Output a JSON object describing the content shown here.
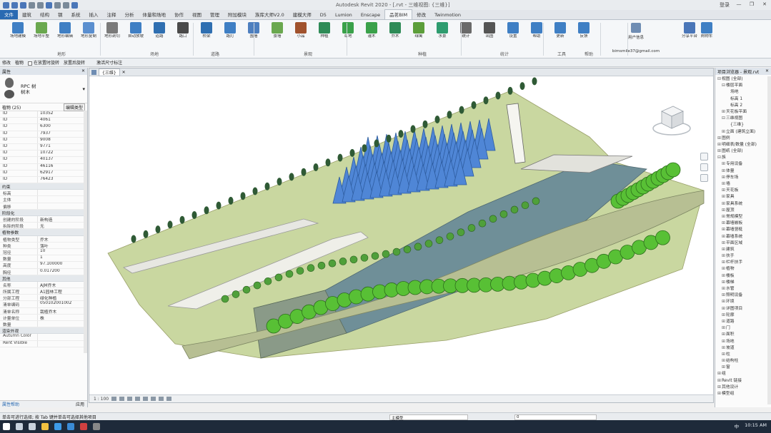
{
  "window": {
    "title": "Autodesk Revit 2020 - [.rvt - 三维视图: {三维}]",
    "user": "登录",
    "controls": [
      "—",
      "❐",
      "✕"
    ]
  },
  "ribbon_tabs": [
    "文件",
    "建筑",
    "结构",
    "钢",
    "系统",
    "插入",
    "注释",
    "分析",
    "体量和场地",
    "协作",
    "视图",
    "管理",
    "附加模块",
    "族库大师V2.0",
    "建模大师",
    "D5",
    "Lumion",
    "Enscape",
    "品茗BIM",
    "修改",
    "Twinmotion"
  ],
  "active_tab": "品茗BIM",
  "ribbon": {
    "buttons": [
      {
        "label": "场地建模",
        "color": "#3f7fc4"
      },
      {
        "label": "场地平整",
        "color": "#6aa84f"
      },
      {
        "label": "地形编辑",
        "color": "#3f7fc4"
      },
      {
        "label": "地形复制",
        "color": "#5b8fcf"
      },
      {
        "label": "地形剖切",
        "color": "#7a7a7a"
      },
      {
        "label": "自动放坡",
        "color": "#3f7fc4"
      },
      {
        "label": "道路",
        "color": "#2f6fb1"
      },
      {
        "label": "路口",
        "color": "#4a4a4a"
      },
      {
        "label": "桥梁",
        "color": "#2f6fb1"
      },
      {
        "label": "路灯",
        "color": "#3f7fc4"
      },
      {
        "label": "围墙",
        "color": "#4d7fbf"
      },
      {
        "label": "景墙",
        "color": "#6aa84f"
      },
      {
        "label": "小品",
        "color": "#a0522d"
      },
      {
        "label": "种植",
        "color": "#2e8b57"
      },
      {
        "label": "草地",
        "color": "#3aa14a"
      },
      {
        "label": "灌木",
        "color": "#3aa14a"
      },
      {
        "label": "乔木",
        "color": "#2e8b57"
      },
      {
        "label": "绿篱",
        "color": "#5c9e3a"
      },
      {
        "label": "水景",
        "color": "#2e9c6f"
      },
      {
        "label": "统计",
        "color": "#6a6a6a"
      },
      {
        "label": "出图",
        "color": "#555555"
      },
      {
        "label": "设置",
        "color": "#3f7fc4"
      },
      {
        "label": "帮助",
        "color": "#3f7fc4"
      },
      {
        "label": "更新",
        "color": "#3f7fc4"
      },
      {
        "label": "反馈",
        "color": "#3f7fc4"
      }
    ],
    "groups": [
      "地形",
      "场地",
      "道路",
      "景观",
      "种植",
      "统计",
      "工具",
      "帮助"
    ],
    "user_label": "用户信息",
    "user_email": "bimsmile37@gmail.com",
    "right_buttons": [
      {
        "label": "分享平台"
      },
      {
        "label": "购物车"
      }
    ]
  },
  "options_bar": {
    "items": [
      "修改",
      "植物"
    ],
    "check1": "在放置时旋转",
    "check2": "放置后旋转",
    "extra": "激活尺寸标注"
  },
  "properties": {
    "title": "属性",
    "type_name_1": "RPC 树",
    "type_name_2": "树木",
    "selector": "植物 (25)",
    "edit_type": "编辑类型",
    "list_rows": [
      {
        "k": "ID",
        "v": "10352"
      },
      {
        "k": "ID",
        "v": "4061"
      },
      {
        "k": "ID",
        "v": "6300"
      },
      {
        "k": "ID",
        "v": "7937"
      },
      {
        "k": "ID",
        "v": "9008"
      },
      {
        "k": "ID",
        "v": "9771"
      },
      {
        "k": "ID",
        "v": "10722"
      },
      {
        "k": "ID",
        "v": "40137"
      },
      {
        "k": "ID",
        "v": "46116"
      },
      {
        "k": "ID",
        "v": "62917"
      },
      {
        "k": "ID",
        "v": "76423"
      }
    ],
    "sections": [
      {
        "title": "约束",
        "rows": [
          {
            "k": "标高",
            "v": ""
          },
          {
            "k": "主体",
            "v": ""
          },
          {
            "k": "偏移",
            "v": ""
          }
        ]
      },
      {
        "title": "阶段化",
        "rows": [
          {
            "k": "创建的阶段",
            "v": "新构造"
          },
          {
            "k": "拆除的阶段",
            "v": "无"
          }
        ]
      },
      {
        "title": "植物参数",
        "rows": [
          {
            "k": "植物类型",
            "v": "乔木"
          },
          {
            "k": "种类",
            "v": "落叶"
          },
          {
            "k": "冠径",
            "v": "10"
          },
          {
            "k": "数量",
            "v": "1"
          },
          {
            "k": "高度",
            "v": "97.100000"
          },
          {
            "k": "胸径",
            "v": "0.017200"
          }
        ]
      },
      {
        "title": "其他",
        "rows": [
          {
            "k": "名称",
            "v": "AJM乔木"
          },
          {
            "k": "所属工程",
            "v": "A1园林工程"
          },
          {
            "k": "分部工程",
            "v": "绿化种植"
          },
          {
            "k": "清单编码",
            "v": "050102001002"
          },
          {
            "k": "清单名称",
            "v": "栽植乔木"
          },
          {
            "k": "计量单位",
            "v": "株"
          },
          {
            "k": "数量",
            "v": ""
          }
        ]
      },
      {
        "title": "渲染外观",
        "rows": [
          {
            "k": "Autumn Color",
            "v": ""
          },
          {
            "k": "Rent Visible",
            "v": ""
          }
        ]
      }
    ],
    "help_link": "属性帮助",
    "apply": "应用"
  },
  "viewport": {
    "tab": "{三维}",
    "viewbar_scale": "1 : 100"
  },
  "browser": {
    "title": "项目浏览器 - 景观.rvt",
    "items": [
      {
        "t": "视图 (全部)",
        "lvl": 0,
        "exp": "⊟"
      },
      {
        "t": "楼层平面",
        "lvl": 1,
        "exp": "⊟"
      },
      {
        "t": "场地",
        "lvl": 2,
        "exp": ""
      },
      {
        "t": "标高 1",
        "lvl": 2,
        "exp": ""
      },
      {
        "t": "标高 2",
        "lvl": 2,
        "exp": ""
      },
      {
        "t": "天花板平面",
        "lvl": 1,
        "exp": "⊞"
      },
      {
        "t": "三维视图",
        "lvl": 1,
        "exp": "⊟"
      },
      {
        "t": "{三维}",
        "lvl": 2,
        "exp": ""
      },
      {
        "t": "立面 (建筑立面)",
        "lvl": 1,
        "exp": "⊞"
      },
      {
        "t": "图例",
        "lvl": 0,
        "exp": "⊞"
      },
      {
        "t": "明细表/数量 (全部)",
        "lvl": 0,
        "exp": "⊞"
      },
      {
        "t": "图纸 (全部)",
        "lvl": 0,
        "exp": "⊞"
      },
      {
        "t": "族",
        "lvl": 0,
        "exp": "⊟"
      },
      {
        "t": "专用设备",
        "lvl": 1,
        "exp": "⊞"
      },
      {
        "t": "体量",
        "lvl": 1,
        "exp": "⊞"
      },
      {
        "t": "停车场",
        "lvl": 1,
        "exp": "⊞"
      },
      {
        "t": "墙",
        "lvl": 1,
        "exp": "⊞"
      },
      {
        "t": "天花板",
        "lvl": 1,
        "exp": "⊞"
      },
      {
        "t": "家具",
        "lvl": 1,
        "exp": "⊞"
      },
      {
        "t": "家具系统",
        "lvl": 1,
        "exp": "⊞"
      },
      {
        "t": "屋顶",
        "lvl": 1,
        "exp": "⊞"
      },
      {
        "t": "常规模型",
        "lvl": 1,
        "exp": "⊞"
      },
      {
        "t": "幕墙嵌板",
        "lvl": 1,
        "exp": "⊞"
      },
      {
        "t": "幕墙竖梃",
        "lvl": 1,
        "exp": "⊞"
      },
      {
        "t": "幕墙系统",
        "lvl": 1,
        "exp": "⊞"
      },
      {
        "t": "平面区域",
        "lvl": 1,
        "exp": "⊞"
      },
      {
        "t": "建筑",
        "lvl": 1,
        "exp": "⊞"
      },
      {
        "t": "扶手",
        "lvl": 1,
        "exp": "⊞"
      },
      {
        "t": "栏杆扶手",
        "lvl": 1,
        "exp": "⊞"
      },
      {
        "t": "植物",
        "lvl": 1,
        "exp": "⊞"
      },
      {
        "t": "楼板",
        "lvl": 1,
        "exp": "⊞"
      },
      {
        "t": "楼梯",
        "lvl": 1,
        "exp": "⊞"
      },
      {
        "t": "水管",
        "lvl": 1,
        "exp": "⊞"
      },
      {
        "t": "照明设备",
        "lvl": 1,
        "exp": "⊞"
      },
      {
        "t": "环境",
        "lvl": 1,
        "exp": "⊞"
      },
      {
        "t": "详图项目",
        "lvl": 1,
        "exp": "⊞"
      },
      {
        "t": "轮廓",
        "lvl": 1,
        "exp": "⊞"
      },
      {
        "t": "道路",
        "lvl": 1,
        "exp": "⊞"
      },
      {
        "t": "门",
        "lvl": 1,
        "exp": "⊞"
      },
      {
        "t": "面积",
        "lvl": 1,
        "exp": "⊞"
      },
      {
        "t": "场地",
        "lvl": 1,
        "exp": "⊞"
      },
      {
        "t": "坡道",
        "lvl": 1,
        "exp": "⊞"
      },
      {
        "t": "柱",
        "lvl": 1,
        "exp": "⊞"
      },
      {
        "t": "结构柱",
        "lvl": 1,
        "exp": "⊞"
      },
      {
        "t": "窗",
        "lvl": 1,
        "exp": "⊞"
      },
      {
        "t": "组",
        "lvl": 0,
        "exp": "⊞"
      },
      {
        "t": "Revit 链接",
        "lvl": 0,
        "exp": "⊞"
      },
      {
        "t": "其他设计",
        "lvl": 0,
        "exp": "⊞"
      },
      {
        "t": "模型组",
        "lvl": 0,
        "exp": "⊞"
      }
    ]
  },
  "status": {
    "text": "单击可进行选择; 按 Tab 键并单击可选择其他项目",
    "field1": "主模型",
    "field2": "0"
  },
  "taskbar": {
    "apps": [
      {
        "name": "start",
        "color": "#ffffff"
      },
      {
        "name": "search",
        "color": "#c8d2dd"
      },
      {
        "name": "task-view",
        "color": "#c8d2dd"
      },
      {
        "name": "explorer",
        "color": "#f0c040"
      },
      {
        "name": "browser",
        "color": "#3d9be9"
      },
      {
        "name": "revit",
        "color": "#3a8bd6"
      },
      {
        "name": "app",
        "color": "#d04040"
      },
      {
        "name": "app2",
        "color": "#888888"
      }
    ],
    "time": "10:15 AM",
    "lang": "中"
  },
  "colors": {
    "ribbon_accent": "#2a6ab2",
    "terrain": "#c9d7a0",
    "water": "#6f8f98",
    "tree_green": "#58c035",
    "conifer_blue": "#4f86d6",
    "dark_tree": "#2f5a35"
  }
}
